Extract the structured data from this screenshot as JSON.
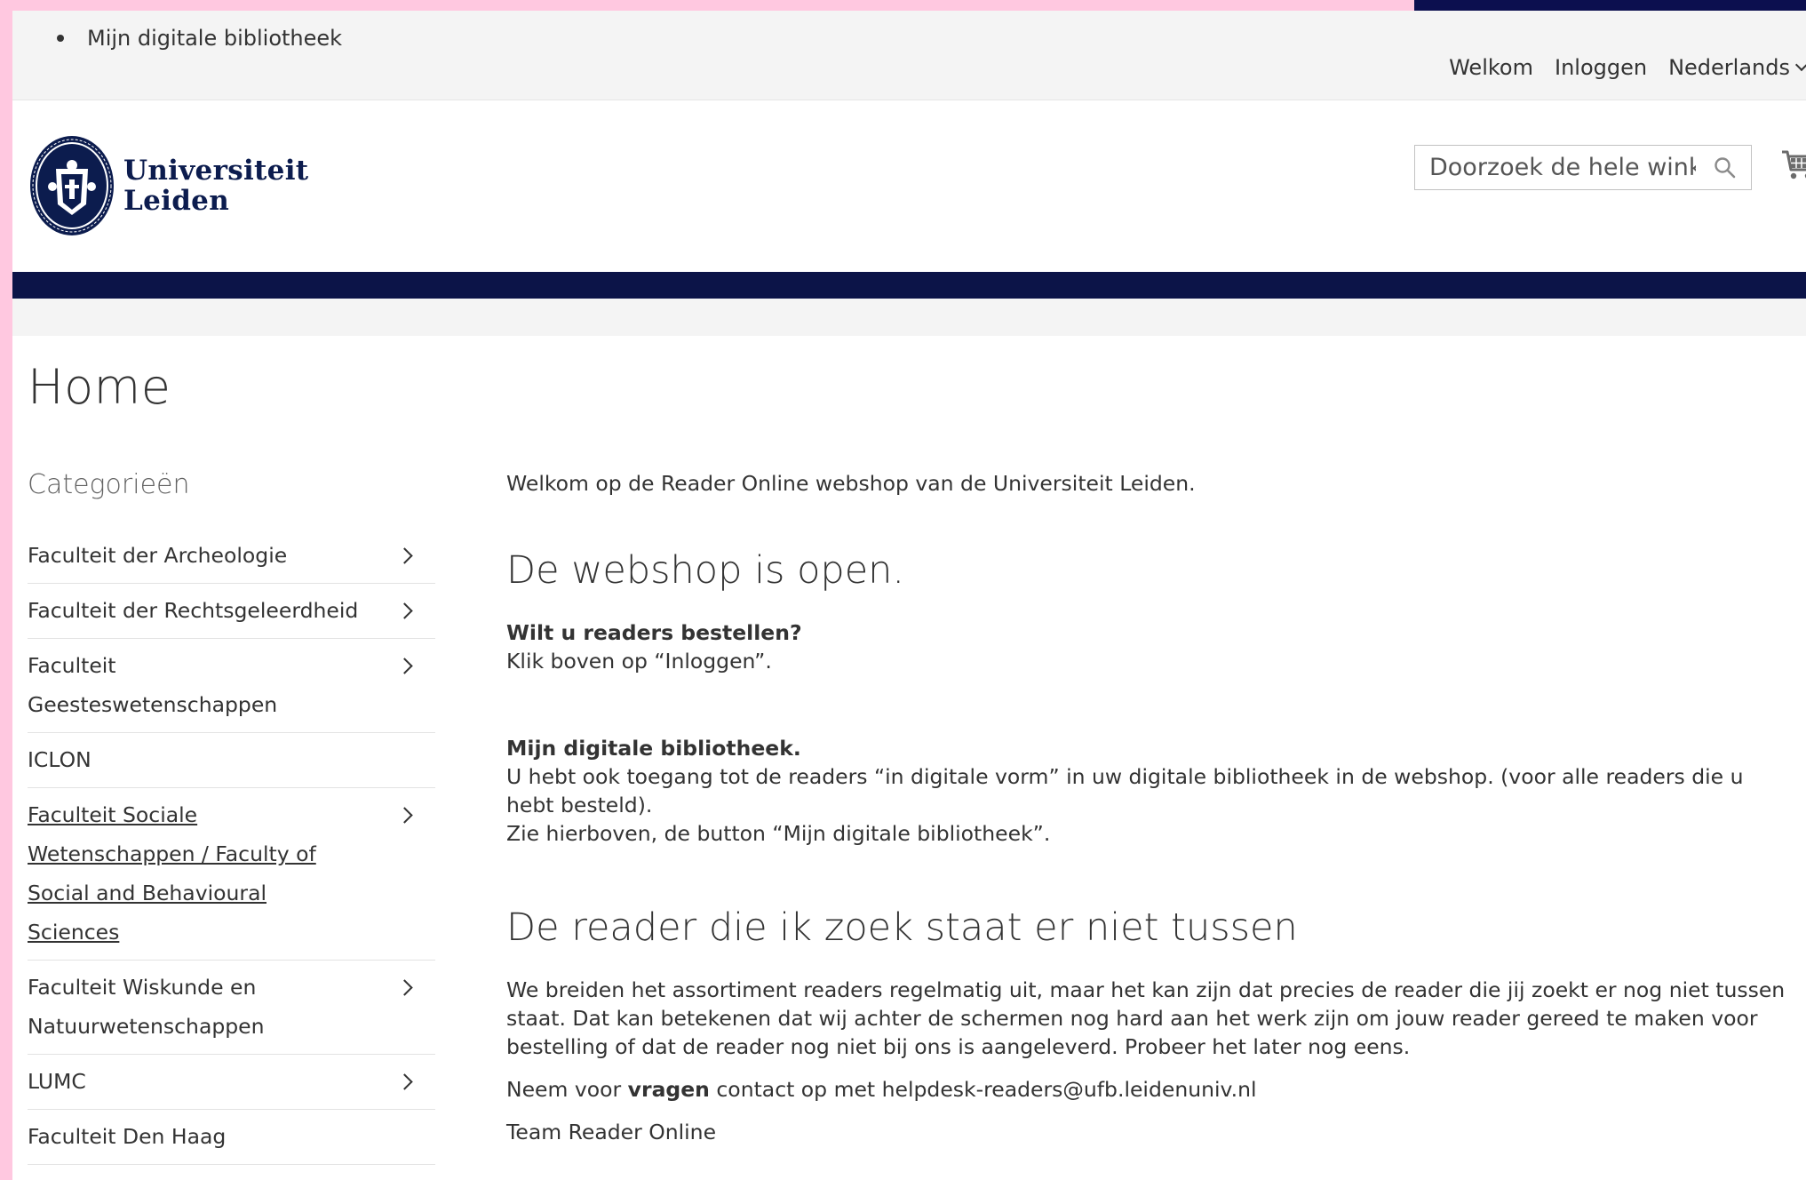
{
  "topbar": {
    "link": "Mijn digitale bibliotheek",
    "welcome": "Welkom",
    "login": "Inloggen",
    "language": "Nederlands"
  },
  "header": {
    "logo_line1": "Universiteit",
    "logo_line2": "Leiden",
    "search_placeholder": "Doorzoek de hele winkel",
    "search_icon": "search-icon",
    "cart_icon": "cart-icon"
  },
  "colors": {
    "navy": "#0c1448",
    "pink_frame": "#ffc8e0",
    "topbar_bg": "#f4f4f4"
  },
  "page": {
    "title": "Home"
  },
  "sidebar": {
    "title": "Categorieën",
    "items": [
      {
        "label": "Faculteit der Archeologie",
        "has_children": true
      },
      {
        "label": "Faculteit der Rechtsgeleerdheid",
        "has_children": true
      },
      {
        "label": "Faculteit Geesteswetenschappen",
        "has_children": true
      },
      {
        "label": "ICLON",
        "has_children": false
      },
      {
        "label": "Faculteit Sociale Wetenschappen / Faculty of Social and Behavioural Sciences",
        "has_children": true
      },
      {
        "label": "Faculteit Wiskunde en Natuurwetenschappen",
        "has_children": true
      },
      {
        "label": "LUMC",
        "has_children": true
      },
      {
        "label": "Faculteit Den Haag",
        "has_children": false
      }
    ]
  },
  "main": {
    "intro": "Welkom op de Reader Online webshop van de Universiteit Leiden.",
    "heading_open": "De webshop is open.",
    "order_question": "Wilt u readers bestellen?",
    "order_instruction": "Klik boven op “Inloggen”.",
    "library_title": "Mijn digitale bibliotheek.",
    "library_line1": "U hebt ook toegang tot de readers “in digitale vorm” in uw digitale bibliotheek in de webshop. (voor alle readers die u hebt besteld).",
    "library_line2": "Zie hierboven, de button “Mijn digitale bibliotheek”.",
    "heading_missing": "De reader die ik zoek staat er niet tussen",
    "missing_text": "We breiden het assortiment readers regelmatig uit, maar het kan zijn dat precies de reader die jij zoekt er nog niet tussen staat. Dat kan betekenen dat wij achter de schermen nog hard aan het werk zijn om jouw reader gereed te maken voor bestelling of dat de reader nog niet bij ons is aangeleverd. Probeer het later nog eens.",
    "contact_prefix": "Neem voor ",
    "contact_bold": "vragen",
    "contact_suffix": " contact op met helpdesk-readers@ufb.leidenuniv.nl",
    "signature": "Team Reader Online"
  }
}
